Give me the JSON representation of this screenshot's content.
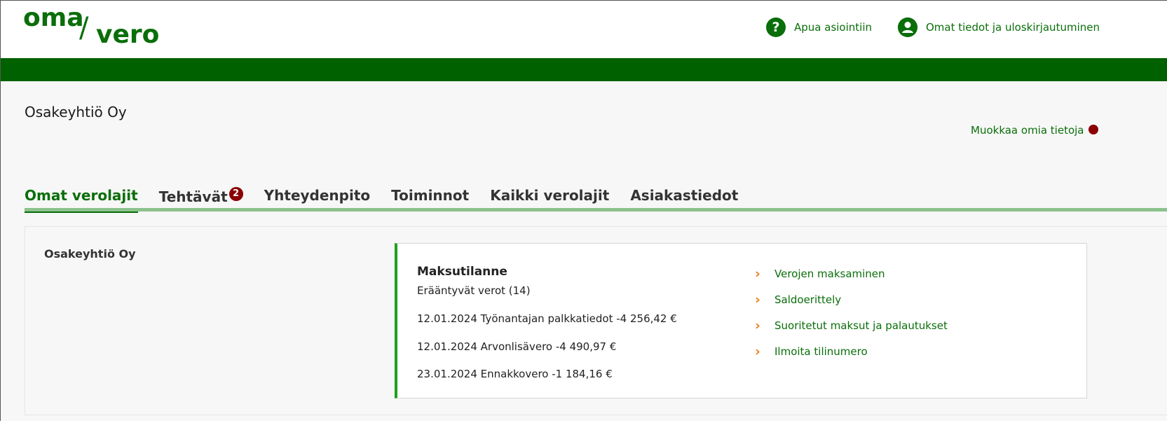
{
  "header": {
    "logo_oma": "oma",
    "logo_slash": "/",
    "logo_vero": "vero",
    "help_label": "Apua asiointiin",
    "help_icon": "?",
    "account_label": "Omat tiedot ja uloskirjautuminen"
  },
  "page": {
    "company_name": "Osakeyhtiö Oy",
    "edit_link": "Muokkaa omia tietoja"
  },
  "tabs": [
    {
      "label": "Omat verolajit",
      "active": true
    },
    {
      "label": "Tehtävät",
      "badge": "2"
    },
    {
      "label": "Yhteydenpito"
    },
    {
      "label": "Toiminnot"
    },
    {
      "label": "Kaikki verolajit"
    },
    {
      "label": "Asiakastiedot"
    }
  ],
  "panel": {
    "company_name": "Osakeyhtiö Oy",
    "card": {
      "title": "Maksutilanne",
      "subtitle": "Erääntyvät verot (14)",
      "rows": [
        "12.01.2024 Työnantajan palkkatiedot -4 256,42 €",
        "12.01.2024 Arvonlisävero -4 490,97 €",
        "23.01.2024 Ennakkovero -1 184,16 €"
      ],
      "links": [
        "Verojen maksaminen",
        "Saldoerittely",
        "Suoritetut maksut ja palautukset",
        "Ilmoita tilinumero"
      ]
    }
  },
  "colors": {
    "brand_green": "#0a6e0a",
    "bar_green": "#006100",
    "badge_red": "#8b0000",
    "chevron_orange": "#e8821a"
  }
}
